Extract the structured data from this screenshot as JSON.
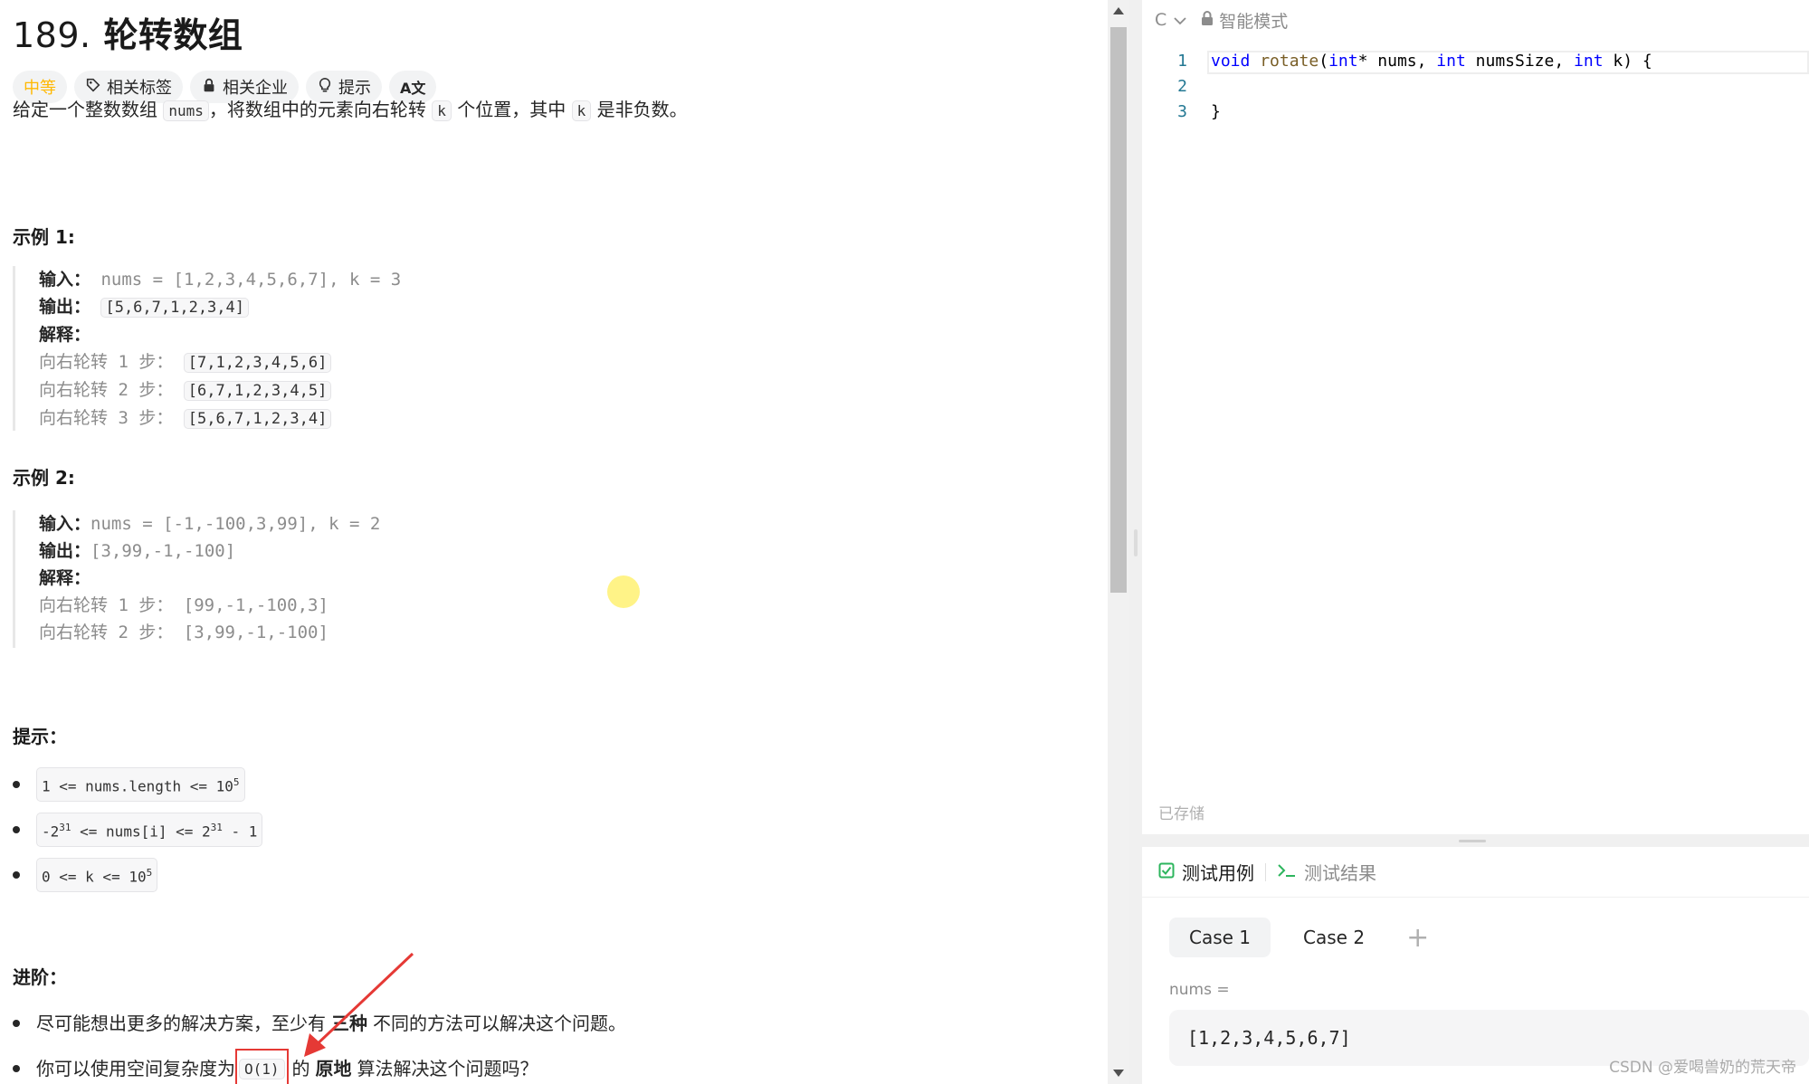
{
  "problem": {
    "number": "189.",
    "title": "轮转数组",
    "tags": {
      "difficulty": "中等",
      "related_tags": "相关标签",
      "related_companies": "相关企业",
      "hint": "提示",
      "translate_glyph": "A文"
    },
    "description": {
      "p1": "给定一个整数数组",
      "code1": "nums",
      "p2": "，将数组中的元素向右轮转",
      "code2": "k",
      "p3": "个位置，其中",
      "code3": "k",
      "p4": "是非负数。"
    },
    "example1": {
      "heading": "示例 1:",
      "input_label": "输入：",
      "input_value": "nums = [1,2,3,4,5,6,7], k = 3",
      "output_label": "输出：",
      "output_value": "[5,6,7,1,2,3,4]",
      "explain_label": "解释：",
      "steps": [
        {
          "text": "向右轮转 1 步：",
          "value": "[7,1,2,3,4,5,6]"
        },
        {
          "text": "向右轮转 2 步：",
          "value": "[6,7,1,2,3,4,5]"
        },
        {
          "text": "向右轮转 3 步：",
          "value": "[5,6,7,1,2,3,4]"
        }
      ]
    },
    "example2": {
      "heading": "示例 2:",
      "input_label": "输入：",
      "input_value": "nums = [-1,-100,3,99], k = 2",
      "output_label": "输出：",
      "output_value": "[3,99,-1,-100]",
      "explain_label": "解释：",
      "steps": [
        {
          "text": "向右轮转 1 步：",
          "value": "[99,-1,-100,3]"
        },
        {
          "text": "向右轮转 2 步：",
          "value": "[3,99,-1,-100]"
        }
      ]
    },
    "constraints": {
      "heading": "提示：",
      "c1": {
        "a": "1 <= nums.length <= 10",
        "sup": "5"
      },
      "c2": {
        "a": "-2",
        "sup1": "31",
        "b": " <= nums[i] <= 2",
        "sup2": "31",
        "c": " - 1"
      },
      "c3": {
        "a": "0 <= k <= 10",
        "sup": "5"
      }
    },
    "advanced": {
      "heading": "进阶：",
      "item1_a": "尽可能想出更多的解决方案，至少有",
      "item1_bold": "三种",
      "item1_b": "不同的方法可以解决这个问题。",
      "item2_a": "你可以使用空间复杂度为",
      "item2_code": "O(1)",
      "item2_b": "的",
      "item2_bold": "原地",
      "item2_c": "算法解决这个问题吗？"
    }
  },
  "editor": {
    "language": "C",
    "mode": "智能模式",
    "lines": [
      {
        "num": "1"
      },
      {
        "num": "2"
      },
      {
        "num": "3"
      }
    ],
    "code": {
      "kw_void": "void",
      "fn_name": "rotate",
      "paren_open": "(",
      "kw_int1": "int",
      "arg1": "* nums, ",
      "kw_int2": "int",
      "arg2": " numsSize, ",
      "kw_int3": "int",
      "arg3": " k) {",
      "close": "}"
    },
    "saved_status": "已存储"
  },
  "testpanel": {
    "tab_testcase": "测试用例",
    "tab_result": "测试结果",
    "cases": [
      "Case 1",
      "Case 2"
    ],
    "add": "+",
    "var_name": "nums =",
    "var_value": "[1,2,3,4,5,6,7]"
  },
  "watermark": "CSDN @爱喝兽奶的荒天帝",
  "colors": {
    "difficulty_medium": "#ffb800",
    "annotation_red": "#e53935",
    "cursor_highlight": "#fff27a",
    "keyword_blue": "#0000ff",
    "testcase_green": "#2db55d"
  }
}
